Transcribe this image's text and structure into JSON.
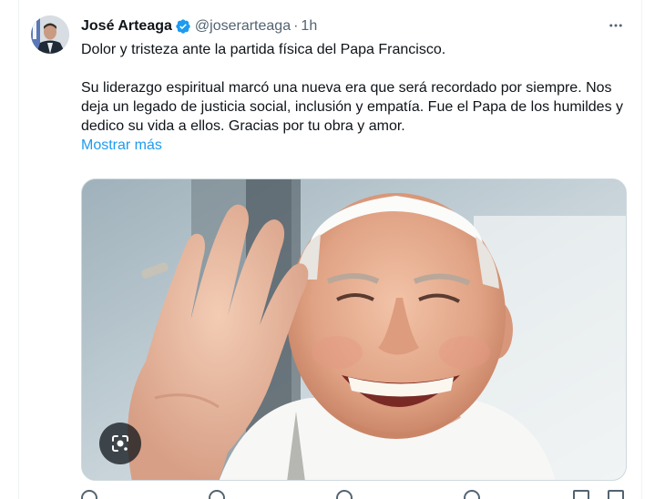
{
  "tweet": {
    "author": {
      "display_name": "José Arteaga",
      "handle": "@joserarteaga",
      "separator": "·",
      "time": "1h",
      "verified_icon": "verified-badge-icon",
      "avatar_icon": "avatar-photo"
    },
    "more_icon": "more-options-icon",
    "text": {
      "line1": "Dolor y tristeza ante la partida física del Papa Francisco.",
      "paragraph2": "Su liderazgo espiritual marcó una nueva era que será recordado por siempre. Nos deja un legado de justicia social, inclusión y empatía. Fue el Papa de los humildes y dedico su vida a ellos. Gracias por tu obra y amor.",
      "show_more": "Mostrar más"
    },
    "media": {
      "description_icon": "photo-of-smiling-pope-waving",
      "lens_icon": "google-lens-icon"
    },
    "actions": [
      "reply-icon",
      "repost-icon",
      "like-icon",
      "views-icon",
      "bookmark-icon",
      "share-icon"
    ]
  },
  "colors": {
    "text_primary": "#0f1419",
    "text_secondary": "#536471",
    "link": "#1d9bf0",
    "verified": "#1d9bf0"
  }
}
